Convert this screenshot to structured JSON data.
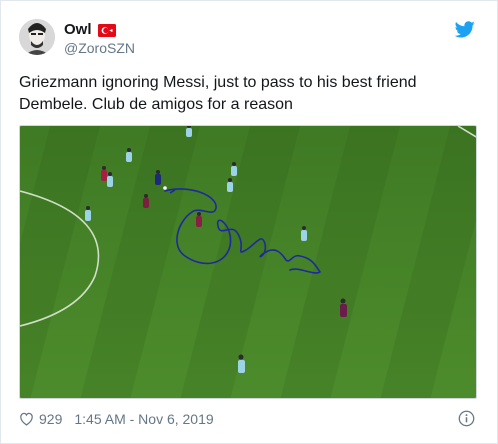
{
  "author": {
    "name": "Owl",
    "handle": "@ZoroSZN",
    "flag": "turkey-flag",
    "verified": false
  },
  "icons": {
    "brand": "twitter-bird-icon",
    "like": "heart-icon",
    "info": "info-icon"
  },
  "tweet": {
    "text_line1": "Griezmann ignoring Messi, just to pass to his best friend",
    "text_line2": "Dembele. Club de amigos for a reason"
  },
  "media": {
    "description_tag": "football-pitch-screenshot",
    "annotation_color": "#1c2a9e",
    "pitch_color": "#4f8a2e"
  },
  "footer": {
    "likes": "929",
    "timestamp": "1:45 AM - Nov 6, 2019"
  },
  "colors": {
    "twitter_blue": "#1da1f2",
    "text_primary": "#14171a",
    "text_secondary": "#657786",
    "flag_red": "#e30a17"
  }
}
